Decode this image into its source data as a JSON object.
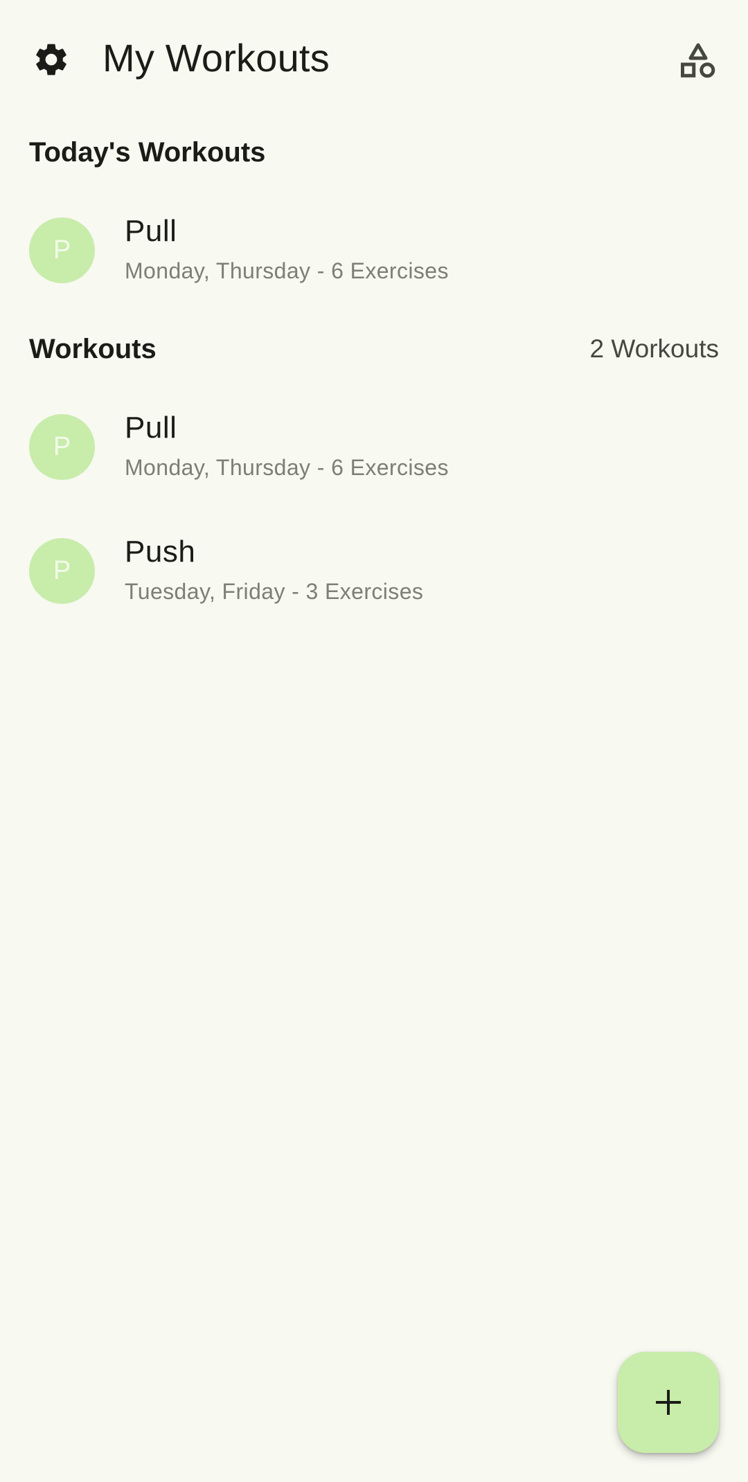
{
  "header": {
    "title": "My Workouts",
    "settings_icon": "gear-icon",
    "shapes_icon": "shapes-icon"
  },
  "today": {
    "title": "Today's Workouts",
    "items": [
      {
        "avatar": "P",
        "name": "Pull",
        "subtitle": "Monday, Thursday - 6 Exercises"
      }
    ]
  },
  "workouts": {
    "title": "Workouts",
    "count": "2 Workouts",
    "items": [
      {
        "avatar": "P",
        "name": "Pull",
        "subtitle": "Monday, Thursday - 6 Exercises"
      },
      {
        "avatar": "P",
        "name": "Push",
        "subtitle": "Tuesday, Friday - 3 Exercises"
      }
    ]
  },
  "fab": {
    "icon": "plus-icon"
  },
  "colors": {
    "background": "#f8f9f1",
    "accent": "#c8ecaa",
    "text": "#1b1c17",
    "secondary_text": "#7c7f76"
  }
}
